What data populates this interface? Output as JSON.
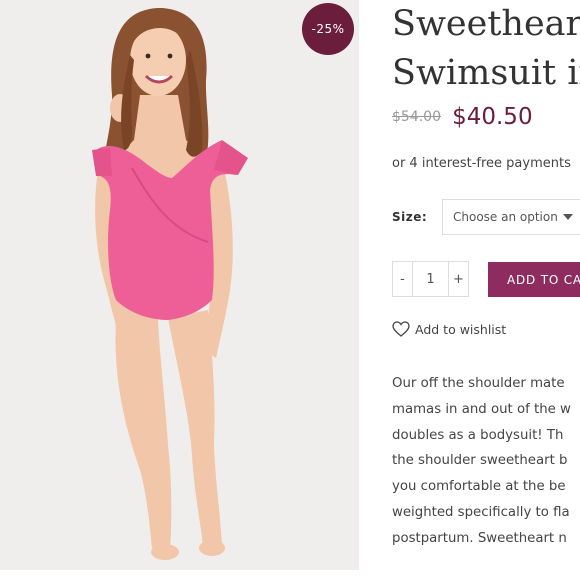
{
  "badge": {
    "label": "-25%"
  },
  "product": {
    "title_line1": "Sweetheart",
    "title_line2": "Swimsuit in",
    "old_price": "$54.00",
    "new_price": "$40.50",
    "installments": "or 4 interest-free payments"
  },
  "variation": {
    "size_label": "Size:",
    "select_value": "Choose an option",
    "chevron_icon": "chevron-down-icon"
  },
  "cart": {
    "minus": "-",
    "quantity": "1",
    "plus": "+",
    "add_label": "ADD TO CART"
  },
  "wishlist": {
    "label": "Add to wishlist",
    "icon": "heart-icon"
  },
  "description_lines": [
    "Our off the shoulder mate",
    "mamas in and out of the w",
    "doubles as a bodysuit! Th",
    "the shoulder sweetheart b",
    "you comfortable at the be",
    "weighted specifically to fla",
    "postpartum. Sweetheart n"
  ],
  "colors": {
    "brand": "#6b1d3c",
    "button": "#8e2c5f",
    "swimsuit": "#ef5f97",
    "image_bg": "#efeeec"
  }
}
